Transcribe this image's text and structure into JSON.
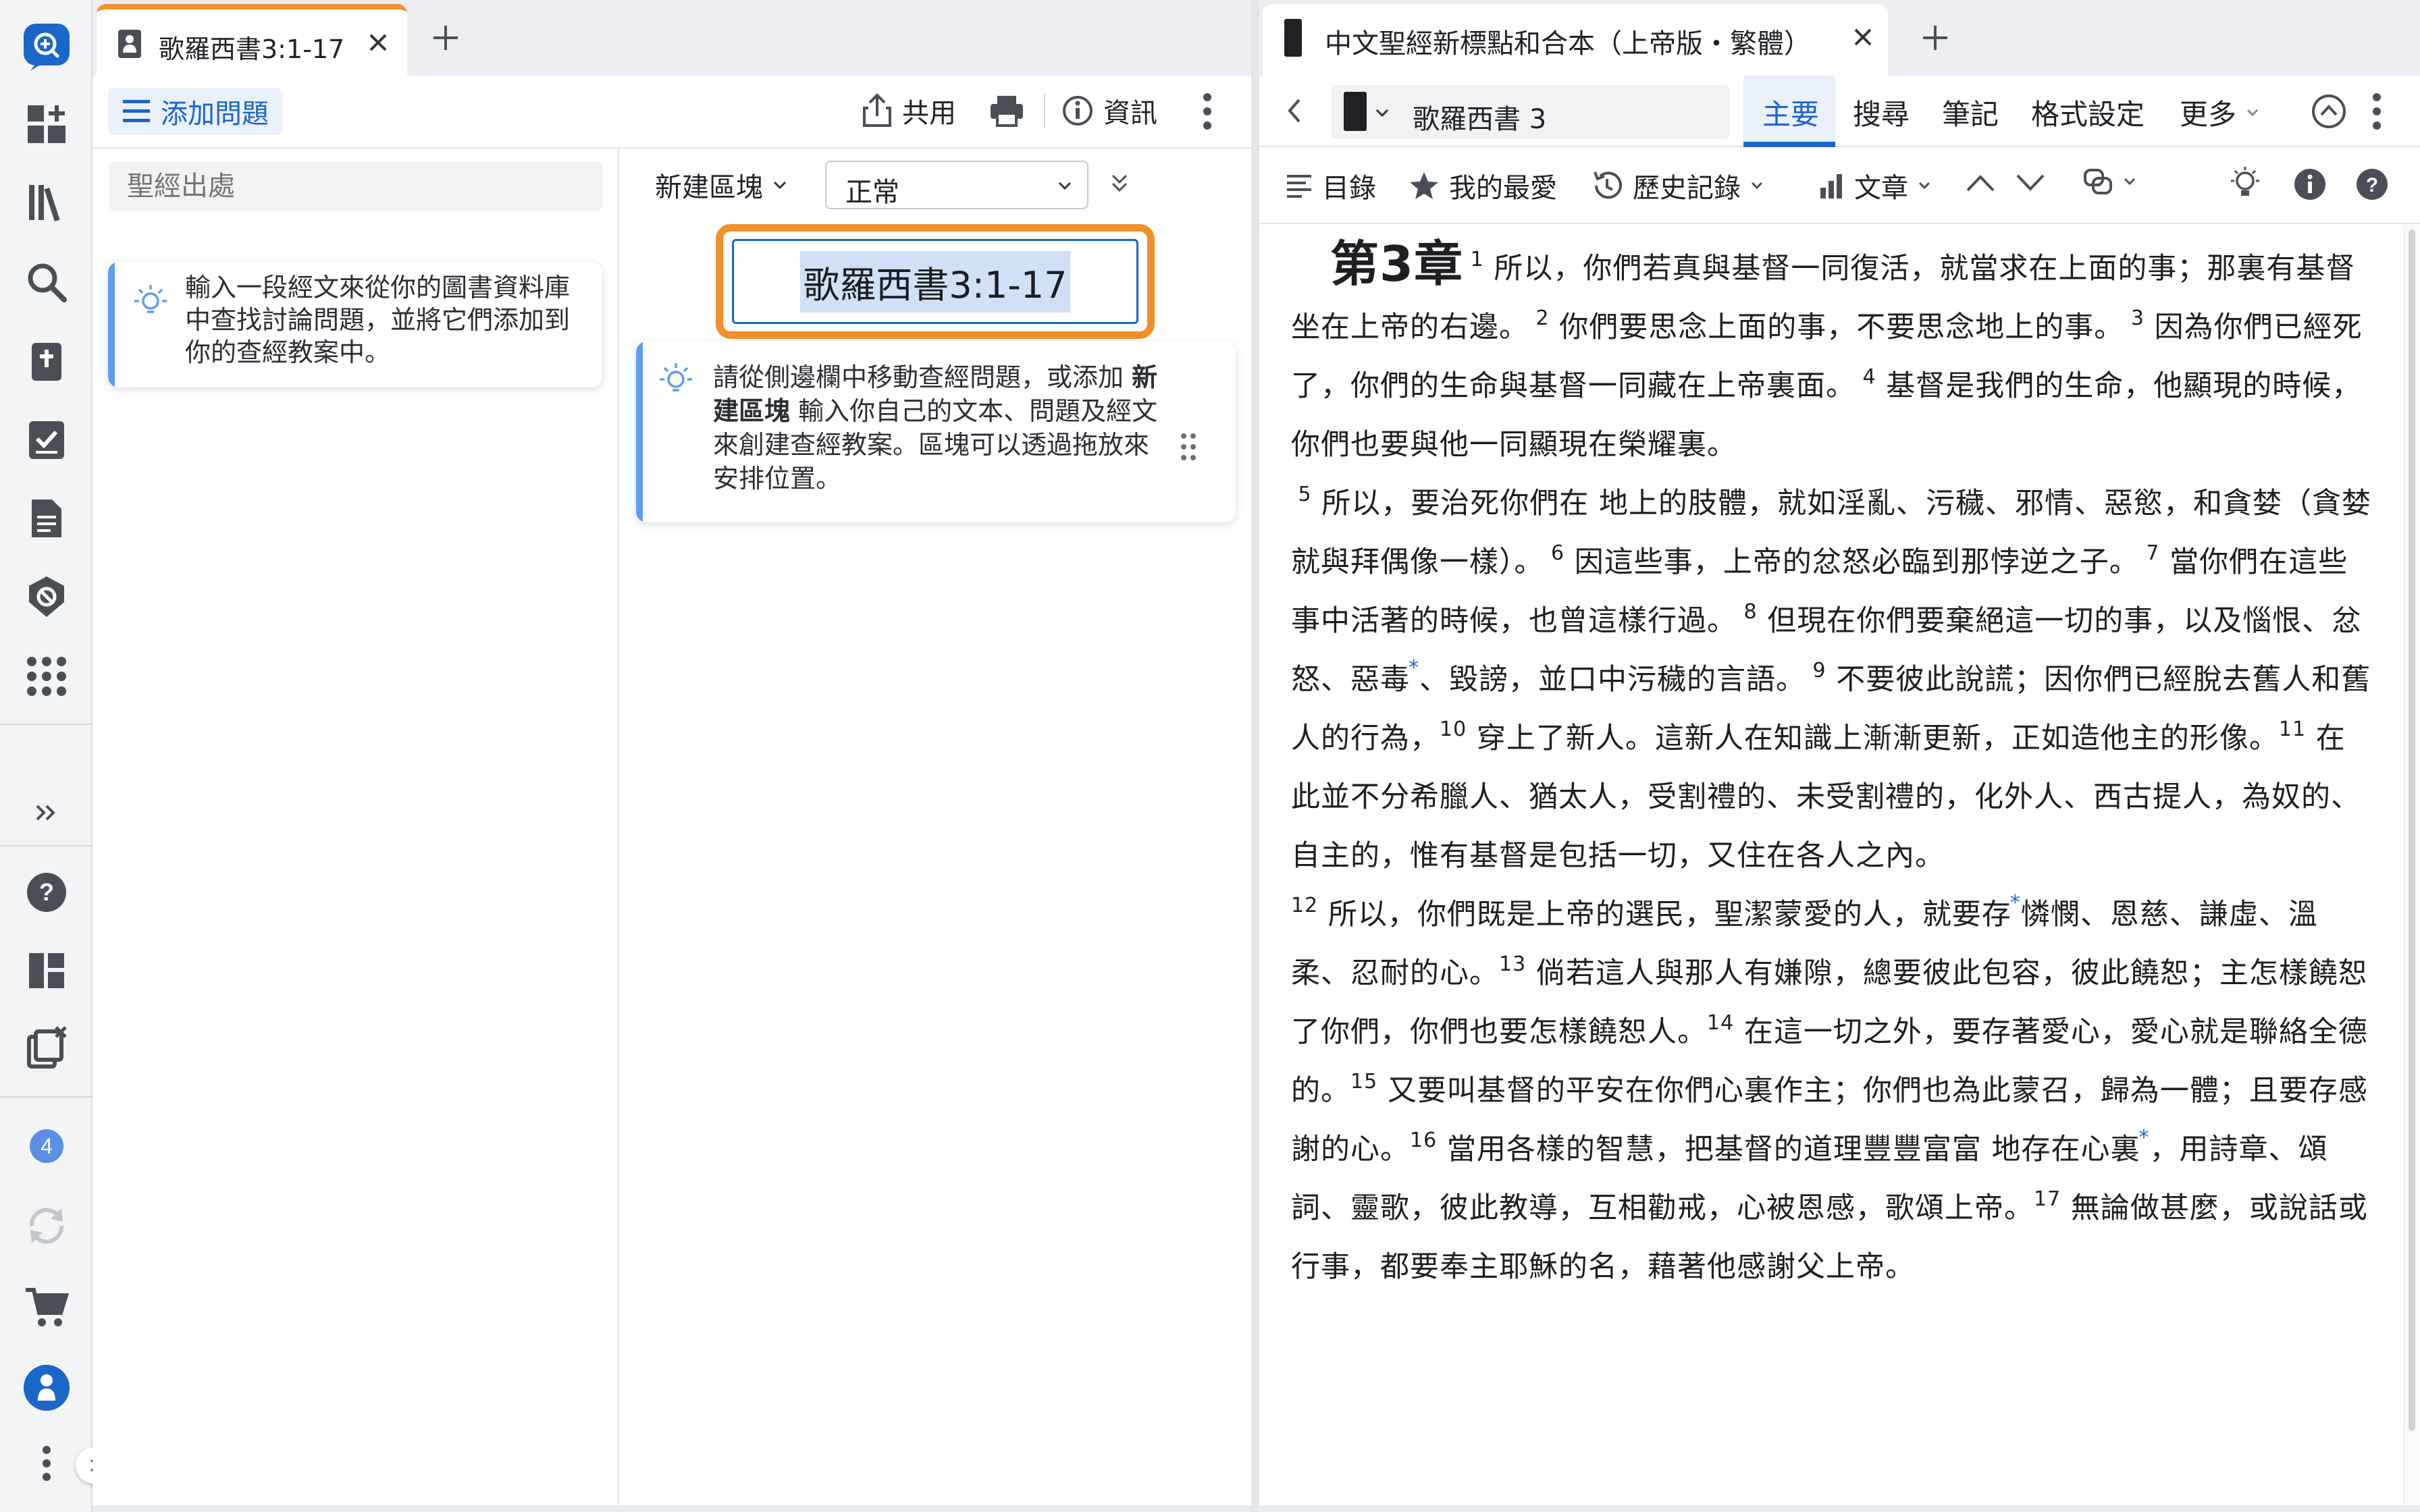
{
  "left_tab": {
    "title": "歌羅西書3:1-17"
  },
  "left_toolbar": {
    "add_question": "添加問題",
    "share": "共用",
    "info": "資訊"
  },
  "sidebar": {
    "search_placeholder": "聖經出處",
    "tip": "輸入一段經文來從你的圖書資料庫中查找討論問題，並將它們添加到你的查經教案中。"
  },
  "builder": {
    "new_block": "新建區塊",
    "style_value": "正常",
    "heading_block": "歌羅西書3:1-17",
    "tip_pre": "請從側邊欄中移動查經問題，或添加 ",
    "tip_bold": "新建區塊",
    "tip_post": " 輸入你自己的文本、問題及經文來創建查經教案。區塊可以透過拖放來安排位置。"
  },
  "right_tab": {
    "title": "中文聖經新標點和合本（上帝版・繁體）"
  },
  "reader_nav": {
    "reference": "歌羅西書 3",
    "tabs": [
      "主要",
      "搜尋",
      "筆記",
      "格式設定",
      "更多"
    ],
    "active_tab": "主要"
  },
  "reader_toolbar": {
    "toc": "目錄",
    "favorites": "我的最愛",
    "history": "歷史記錄",
    "article": "文章"
  },
  "rail": {
    "badge_count": "4"
  },
  "colors": {
    "accent": "#1b66c9",
    "highlight_border": "#f0912c",
    "tip_bar": "#5e9ef2"
  },
  "chapter": {
    "heading": "第3章",
    "verses": {
      "v1": "所以，你們若真與基督一同復活，就當求在上面的事；那裏有基督 坐在上帝的右邊。",
      "v2": "你們要思念上面的事，不要思念地上的事。",
      "v3": "因為你們已經死了，你們的生命與基督一同藏在上帝裏面。",
      "v4": "基督是我們的生命，他顯現的時候，你們也要與他一同顯現在榮耀裏。",
      "v5": "所以，要治死你們在 地上的肢體，就如淫亂、污穢、邪情、惡慾，和貪婪（貪婪就與拜偶像一樣）。",
      "v6": "因這些事，上帝的忿怒必臨到那悖逆之子。",
      "v7": "當你們在這些事中活著的時候，也曾這樣行過。",
      "v8a": "但現在你們要棄絕這一切的事，以及惱恨、忿怒、惡毒",
      "v8b": "、毀謗，並口中污穢的言語。",
      "v9": "不要彼此說謊；因你們已經脫去舊人和舊人的行為，",
      "v10": "穿上了新人。這新人在知識上漸漸更新，正如造他主的形像。",
      "v11": "在此並不分希臘人、猶太人，受割禮的、未受割禮的，化外人、西古提人，為奴的、自主的，惟有基督是包括一切，又住在各人之內。",
      "v12a": "所以，你們既是上帝的選民，聖潔蒙愛的人，就要存",
      "v12b": "憐憫、恩慈、謙虛、溫柔、忍耐的心。",
      "v13": "倘若這人與那人有嫌隙，總要彼此包容，彼此饒恕；主怎樣饒恕了你們，你們也要怎樣饒恕人。",
      "v14": "在這一切之外，要存著愛心，愛心就是聯絡全德的。",
      "v15": "又要叫基督的平安在你們心裏作主；你們也為此蒙召，歸為一體；且要存感謝的心。",
      "v16a": "當用各樣的智慧，把基督的道理豐豐富富 地存在心裏",
      "v16b": "，用詩章、頌詞、靈歌，彼此教導，互相勸戒，心被恩感，歌頌上帝。",
      "v17": "無論做甚麼，或說話或行事，都要奉主耶穌的名，藉著他感謝父上帝。"
    },
    "xref_mark": "*"
  }
}
